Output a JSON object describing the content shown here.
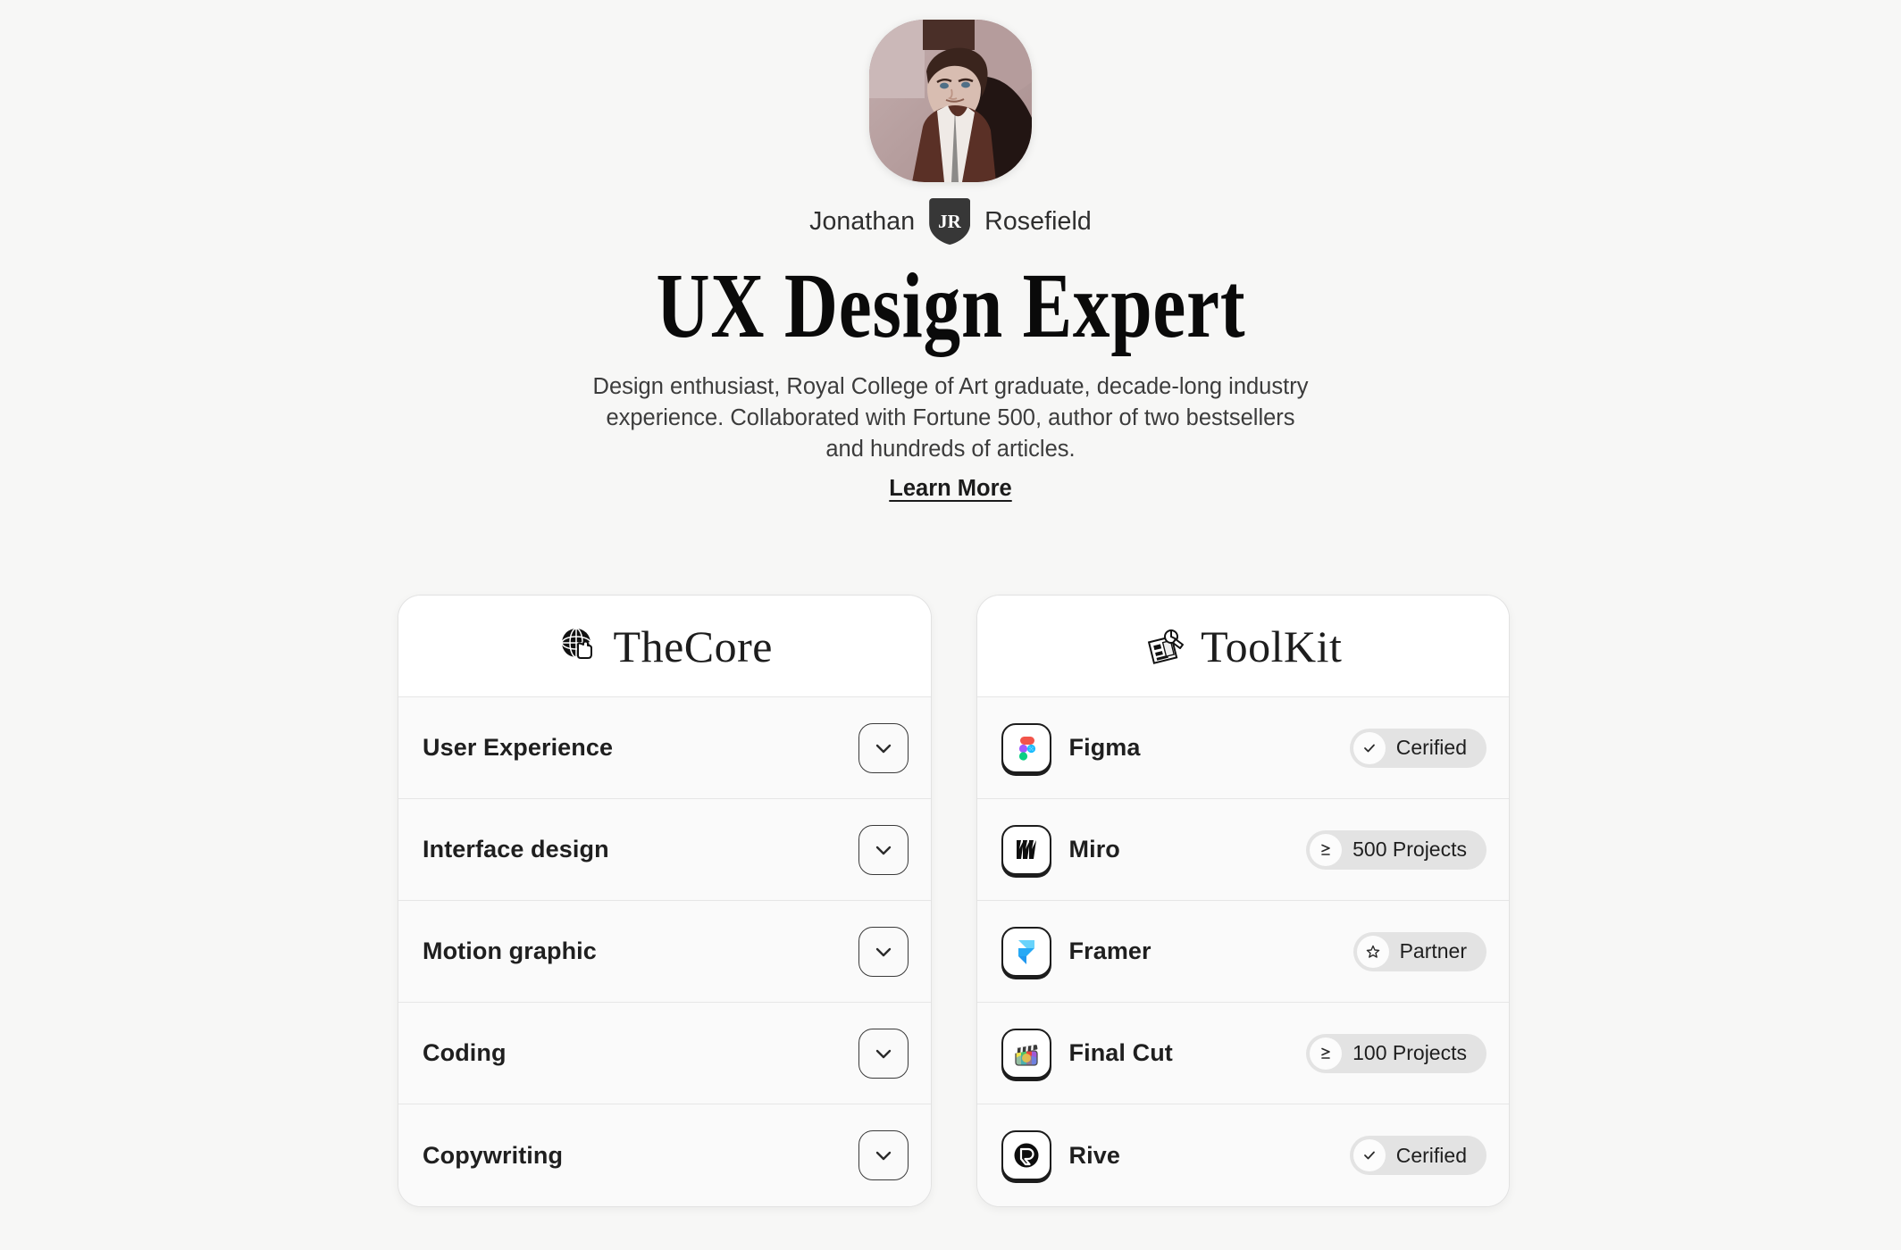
{
  "hero": {
    "avatar_alt": "portrait-photo",
    "first_name": "Jonathan",
    "monogram": "JR",
    "last_name": "Rosefield",
    "headline": "UX Design Expert",
    "description": "Design enthusiast, Royal College of Art graduate, decade-long industry experience. Collaborated with Fortune 500, author of two bestsellers and hundreds of articles.",
    "learn_more": "Learn More"
  },
  "core_card": {
    "title": "TheCore",
    "icon": "globe-pointer-icon",
    "items": [
      {
        "label": "User Experience",
        "control": "chevron-down-icon"
      },
      {
        "label": "Interface design",
        "control": "chevron-down-icon"
      },
      {
        "label": "Motion graphic",
        "control": "chevron-down-icon"
      },
      {
        "label": "Coding",
        "control": "chevron-down-icon"
      },
      {
        "label": "Copywriting",
        "control": "chevron-down-icon"
      }
    ]
  },
  "toolkit_card": {
    "title": "ToolKit",
    "icon": "drafting-board-icon",
    "items": [
      {
        "name": "Figma",
        "icon": "figma-icon",
        "badge": "Cerified",
        "badge_icon": "check-icon"
      },
      {
        "name": "Miro",
        "icon": "miro-icon",
        "badge": "500 Projects",
        "badge_icon": "greater-equal-icon"
      },
      {
        "name": "Framer",
        "icon": "framer-icon",
        "badge": "Partner",
        "badge_icon": "star-icon"
      },
      {
        "name": "Final Cut",
        "icon": "final-cut-icon",
        "badge": "100 Projects",
        "badge_icon": "greater-equal-icon"
      },
      {
        "name": "Rive",
        "icon": "rive-icon",
        "badge": "Cerified",
        "badge_icon": "check-icon"
      }
    ]
  },
  "colors": {
    "page_background": "#f7f7f6",
    "card_background": "#fafafa",
    "card_header": "#ffffff",
    "border": "#e6e6e6",
    "text_primary": "#1f1f1f",
    "text_secondary": "#3c3c3c",
    "pill_background": "#e3e3e3",
    "monogram_background": "#373737"
  }
}
